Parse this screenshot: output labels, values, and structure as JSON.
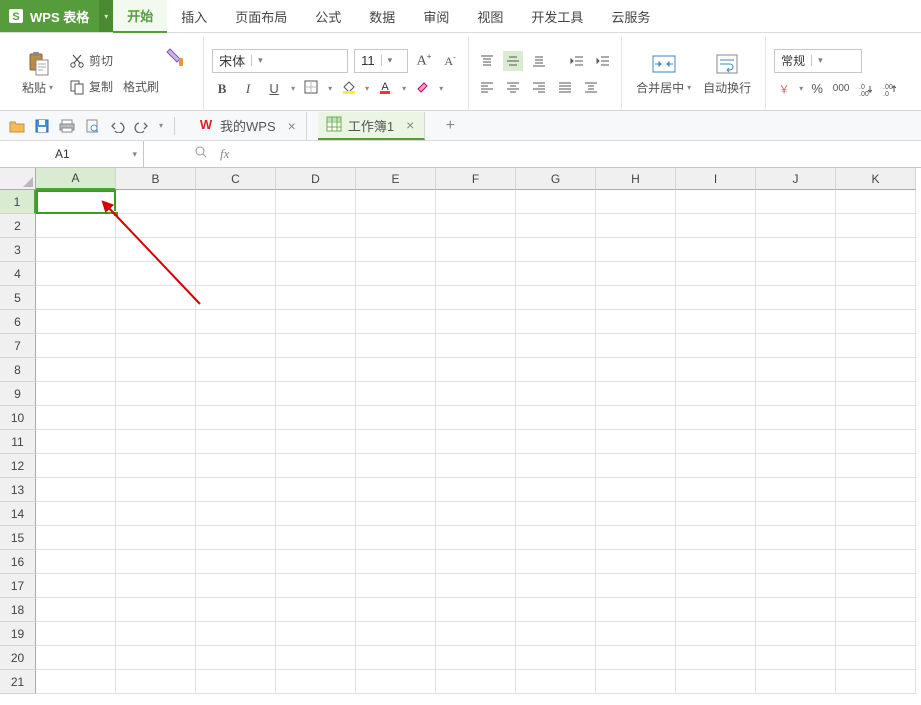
{
  "app": {
    "name": "WPS 表格"
  },
  "menu": {
    "items": [
      "开始",
      "插入",
      "页面布局",
      "公式",
      "数据",
      "审阅",
      "视图",
      "开发工具",
      "云服务"
    ],
    "active_index": 0
  },
  "ribbon": {
    "paste_drop": "粘贴",
    "cut": "剪切",
    "copy": "复制",
    "formatpaint": "格式刷",
    "font_name": "宋体",
    "font_size": "11",
    "bold": "B",
    "italic": "I",
    "underline": "U",
    "merge_center": "合并居中",
    "wrap_text": "自动换行",
    "number_format": "常规"
  },
  "doc_tabs": {
    "items": [
      {
        "label": "我的WPS",
        "active": false
      },
      {
        "label": "工作簿1",
        "active": true
      }
    ]
  },
  "formula_bar": {
    "cell_ref": "A1",
    "fx": "fx"
  },
  "grid": {
    "columns": [
      "A",
      "B",
      "C",
      "D",
      "E",
      "F",
      "G",
      "H",
      "I",
      "J",
      "K"
    ],
    "rows": [
      "1",
      "2",
      "3",
      "4",
      "5",
      "6",
      "7",
      "8",
      "9",
      "10",
      "11",
      "12",
      "13",
      "14",
      "15",
      "16",
      "17",
      "18",
      "19",
      "20",
      "21"
    ],
    "selected_col_index": 0,
    "selected_row_index": 0
  }
}
